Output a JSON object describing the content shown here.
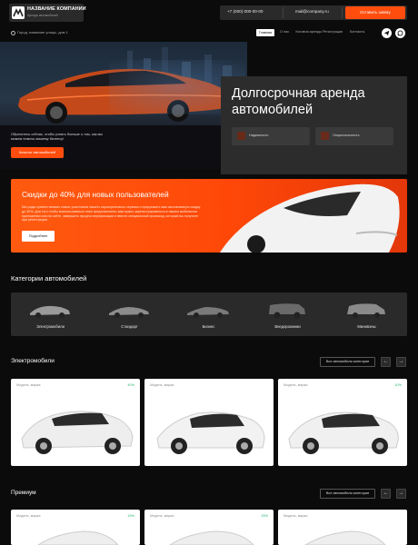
{
  "header": {
    "company_name": "НАЗВАНИЕ КОМПАНИИ",
    "company_sub": "Аренда автомобилей",
    "phone": "+7 (000) 000-00-00",
    "email": "mail@company.ru",
    "request_button": "Оставить заявку"
  },
  "nav": {
    "city": "Город, название улицы, дом 1",
    "items": [
      "Главная",
      "О нас",
      "Условия аренды",
      "Регистрация",
      "Контакты"
    ],
    "active": "Главная",
    "social_icons": [
      "telegram-icon",
      "whatsapp-icon"
    ]
  },
  "hero": {
    "title": "Долгосрочная аренда автомобилей",
    "description": "Обратитесь сейчас, чтобы узнать больше о том, как мы можем помочь вашему бизнесу!",
    "catalog_button": "Каталог автомобилей",
    "features": [
      "Надежность",
      "Опциональность"
    ]
  },
  "promo": {
    "title": "Скидки до 40% для новых пользователей",
    "text": "Мы рады приветствовать новых участников нашего каршерингового сервиса и предложить вам эксклюзивную скидку до 40%. Для того чтобы воспользоваться этим предложением, вам нужно зарегистрироваться в нашем мобильном приложении или на сайте, завершить процесс верификации и ввести специальный промокод, который вы получите при регистрации.",
    "button": "Подробнее"
  },
  "categories": {
    "title": "Категории автомобилей",
    "items": [
      "Электромобили",
      "Стандарт",
      "Бизнес",
      "Внедорожники",
      "Минивэны"
    ]
  },
  "electric": {
    "title": "Электромобили",
    "all_button": "Все автомобили категории",
    "prev": "←",
    "next": "→",
    "cards": [
      {
        "model": "Модель, марка",
        "discount": "40%"
      },
      {
        "model": "Модель, марка",
        "discount": ""
      },
      {
        "model": "Модель, марка",
        "discount": "10%"
      }
    ]
  },
  "premium": {
    "title": "Премиум",
    "all_button": "Все автомобили категории",
    "prev": "←",
    "next": "→",
    "cards": [
      {
        "model": "Модель, марка",
        "discount": "15%"
      },
      {
        "model": "Модель, марка",
        "discount": "25%"
      },
      {
        "model": "Модель, марка",
        "discount": ""
      }
    ]
  },
  "colors": {
    "accent": "#ff4d0d",
    "background": "#0b0b0b",
    "panel": "#2a2a2a",
    "discount": "#2bb673"
  }
}
